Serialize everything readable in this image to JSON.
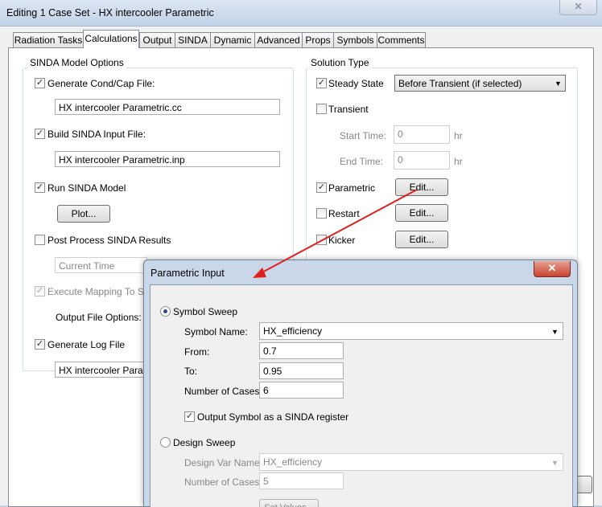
{
  "window": {
    "title": "Editing 1 Case Set - HX intercooler Parametric",
    "close_glyph": "✕"
  },
  "tabs": [
    "Radiation Tasks",
    "Calculations",
    "Output",
    "SINDA",
    "Dynamic",
    "Advanced",
    "Props",
    "Symbols",
    "Comments"
  ],
  "sinda": {
    "legend": "SINDA Model Options",
    "gen_cond_label": "Generate Cond/Cap File:",
    "gen_cond_value": "HX intercooler Parametric.cc",
    "build_label": "Build SINDA Input File:",
    "build_value": "HX intercooler Parametric.inp",
    "run_label": "Run SINDA Model",
    "plot_btn": "Plot...",
    "post_label": "Post Process SINDA Results",
    "current_time": "Current Time",
    "exec_label": "Execute Mapping To Stre",
    "output_opts": "Output File Options:",
    "log_label": "Generate Log File",
    "log_value": "HX intercooler Parame"
  },
  "solution": {
    "legend": "Solution Type",
    "steady_label": "Steady State",
    "steady_combo": "Before Transient (if selected)",
    "transient_label": "Transient",
    "start_label": "Start Time:",
    "start_value": "0",
    "end_label": "End Time:",
    "end_value": "0",
    "unit": "hr",
    "parametric_label": "Parametric",
    "restart_label": "Restart",
    "kicker_label": "Kicker",
    "edit_btn": "Edit..."
  },
  "dialog": {
    "title": "Parametric Input",
    "close_glyph": "✕",
    "symbol_sweep": "Symbol Sweep",
    "symbol_name_label": "Symbol Name:",
    "symbol_name_value": "HX_efficiency",
    "from_label": "From:",
    "from_value": "0.7",
    "to_label": "To:",
    "to_value": "0.95",
    "cases_label": "Number of Cases:",
    "cases_value": "6",
    "output_symbol_label": "Output Symbol as a SINDA register",
    "design_sweep": "Design Sweep",
    "design_var_label": "Design Var Name:",
    "design_var_value": "HX_efficiency",
    "design_cases_label": "Number of Cases:",
    "design_cases_value": "5",
    "set_values_btn": "Set Values..."
  },
  "colors": {
    "arrow": "#e0201e",
    "dialog_frame": "#c9d7e8"
  },
  "checkmark": "✓",
  "dropdown_glyph": "▼"
}
